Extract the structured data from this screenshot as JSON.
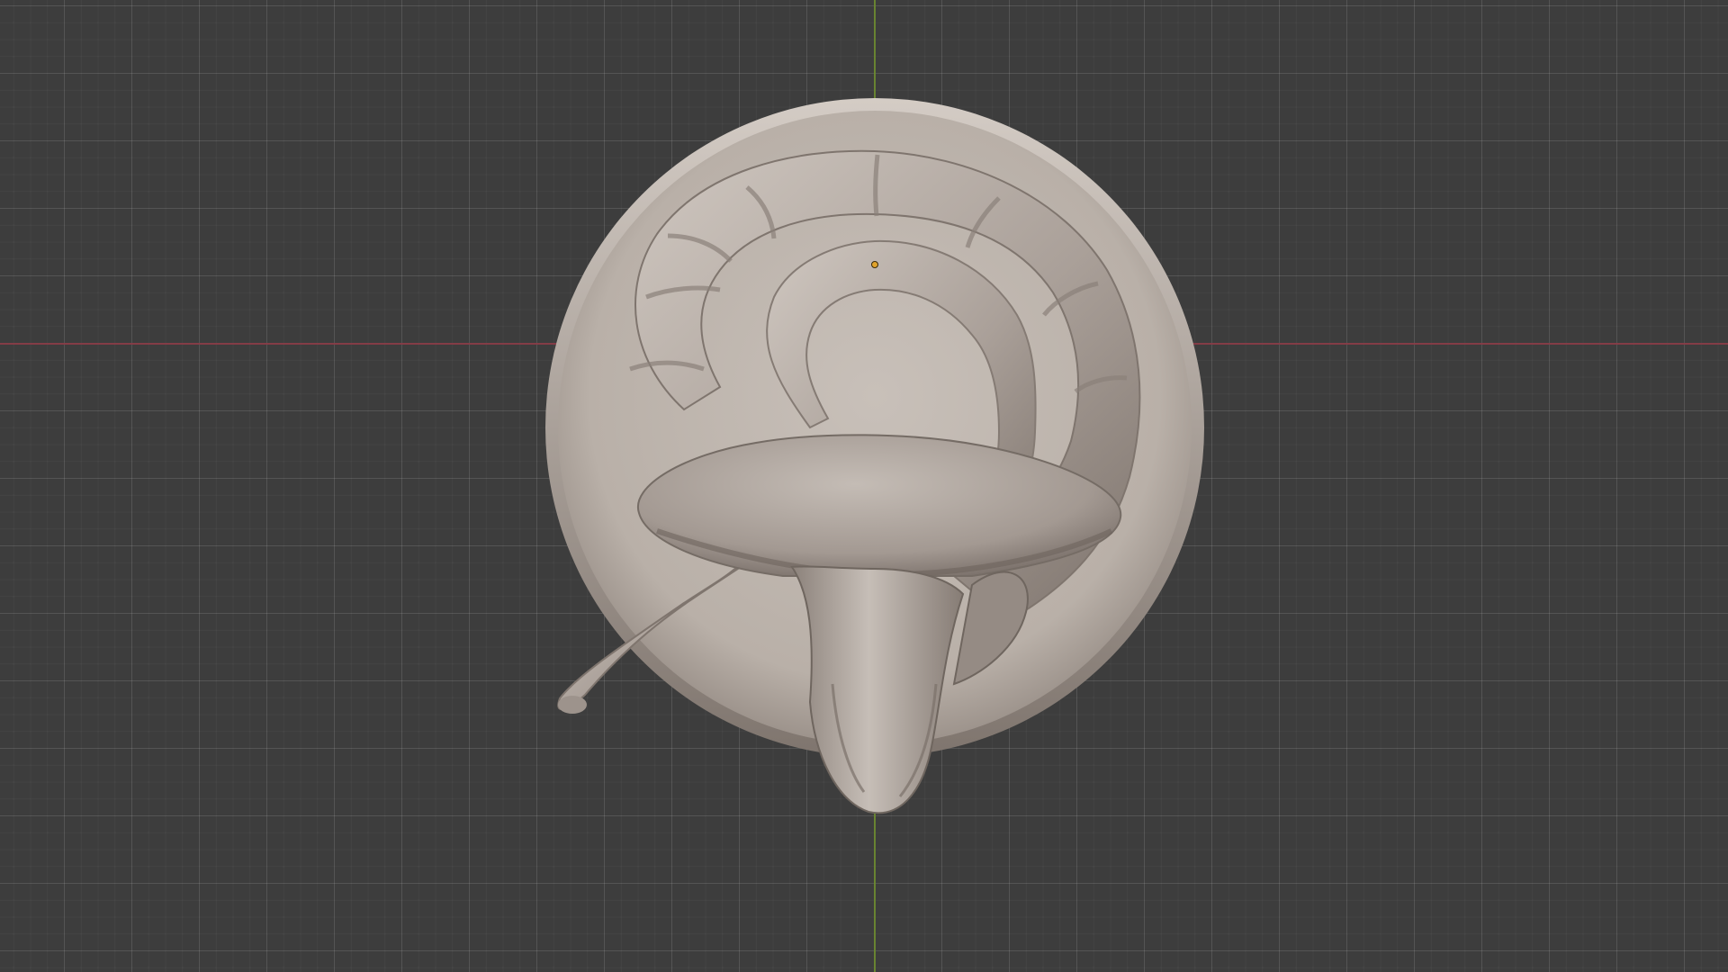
{
  "viewport": {
    "background_color": "#3d3d3d",
    "grid": true,
    "x_axis_color": "#8a3b46",
    "y_axis_color": "#6c8a2f",
    "origin_marker_color": "#e0a32c"
  },
  "model": {
    "material_color": "#b5aba3",
    "shadow_color": "#7d736c",
    "highlight_color": "#d7cfc8",
    "parts": [
      "base-disc",
      "segmented-horn-tail",
      "mushroom-cap",
      "head-snout"
    ]
  }
}
